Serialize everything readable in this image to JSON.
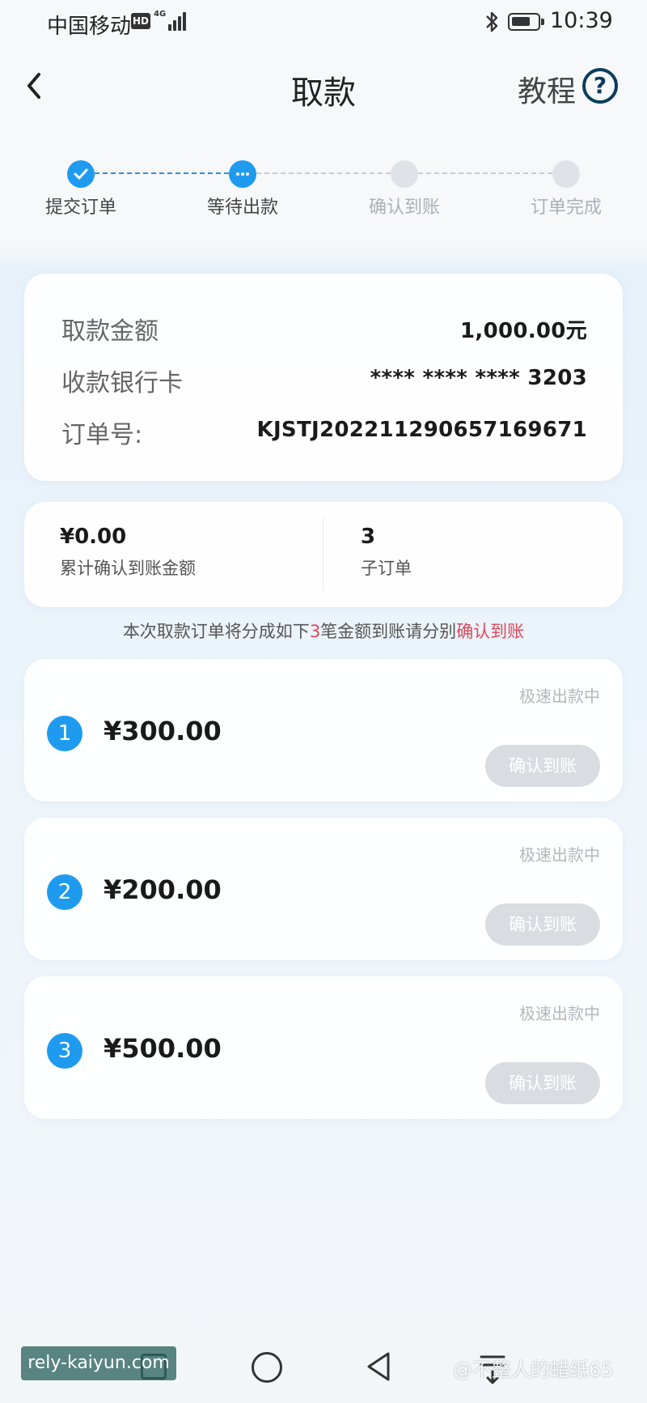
{
  "status_bar": {
    "carrier": "中国移动",
    "hd": "HD",
    "network": "4G",
    "time": "10:39"
  },
  "header": {
    "title": "取款",
    "tutorial_label": "教程",
    "help_icon_text": "?"
  },
  "stepper": {
    "steps": [
      {
        "label": "提交订单",
        "state": "done"
      },
      {
        "label": "等待出款",
        "state": "current"
      },
      {
        "label": "确认到账",
        "state": "pending"
      },
      {
        "label": "订单完成",
        "state": "pending"
      }
    ]
  },
  "order_info": {
    "rows": [
      {
        "label": "取款金额",
        "value": "1,000.00元"
      },
      {
        "label": "收款银行卡",
        "value": "**** **** **** 3203"
      },
      {
        "label": "订单号:",
        "value": "KJSTJ202211290657169671"
      }
    ]
  },
  "summary": {
    "confirmed_amount": "¥0.00",
    "confirmed_amount_label": "累计确认到账金额",
    "sub_order_count": "3",
    "sub_order_label": "子订单"
  },
  "notice": {
    "prefix": "本次取款订单将分成如下",
    "count": "3",
    "middle": "笔金额到账请分别",
    "highlight": "确认到账"
  },
  "sub_orders": [
    {
      "index": "1",
      "amount": "¥300.00",
      "status": "极速出款中",
      "button": "确认到账"
    },
    {
      "index": "2",
      "amount": "¥200.00",
      "status": "极速出款中",
      "button": "确认到账"
    },
    {
      "index": "3",
      "amount": "¥500.00",
      "status": "极速出款中",
      "button": "确认到账"
    }
  ],
  "watermarks": {
    "left": "rely-kaiyun.com",
    "right": "@不整人的蜡纸65"
  },
  "colors": {
    "accent": "#1e9bef",
    "highlight": "#e0455b",
    "disabled_button": "#d9dde1"
  }
}
